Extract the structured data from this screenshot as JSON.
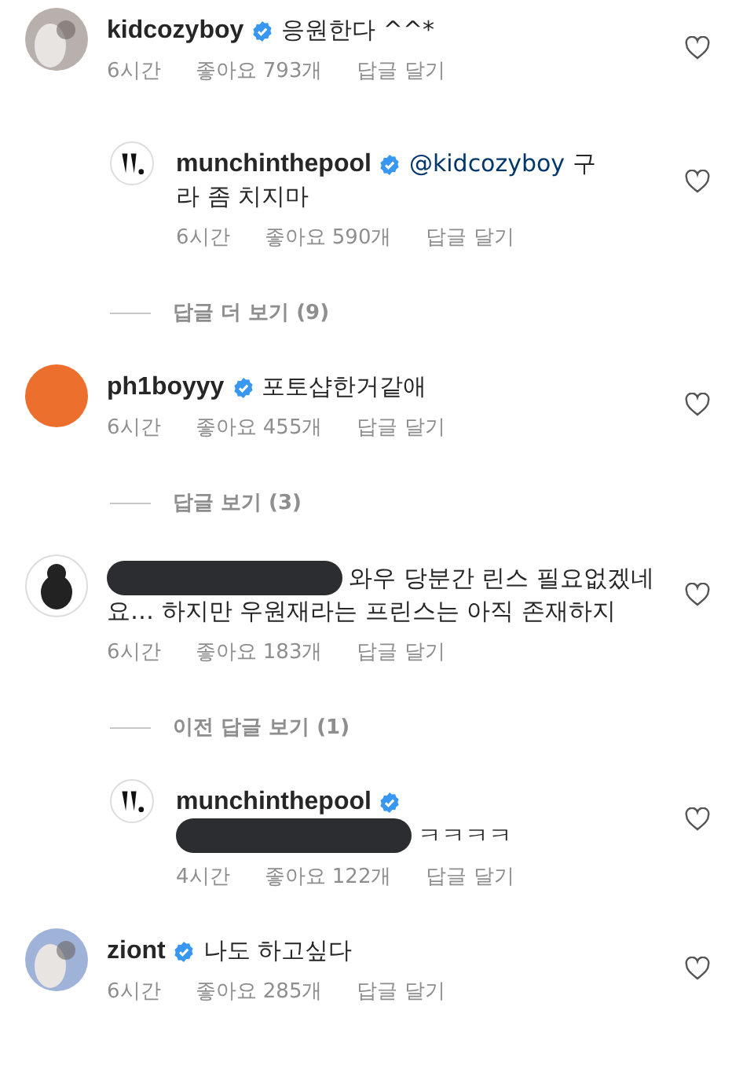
{
  "comments": [
    {
      "username": "kidcozyboy",
      "verified": true,
      "text": [
        "응원한다 ^^*"
      ],
      "avatar": {
        "kind": "photo",
        "color": "#b8b0ac"
      },
      "time": "6시간",
      "likes": "좋아요 793개",
      "reply": "답글 달기",
      "liked": false,
      "children": [
        {
          "kind": "reply",
          "username": "munchinthepool",
          "verified": true,
          "mention": "@kidcozyboy",
          "text": [
            "구",
            "라 좀 치지마"
          ],
          "avatar": {
            "kind": "logo",
            "color": "#111111"
          },
          "time": "6시간",
          "likes": "좋아요 590개",
          "reply": "답글 달기",
          "liked": false
        },
        {
          "kind": "toggle",
          "label": "답글 더 보기 (9)"
        }
      ]
    },
    {
      "username": "ph1boyyy",
      "verified": true,
      "text": [
        "포토샵한거같애"
      ],
      "avatar": {
        "kind": "plain",
        "color": "#ec6f2d"
      },
      "time": "6시간",
      "likes": "좋아요 455개",
      "reply": "답글 달기",
      "liked": false,
      "children": [
        {
          "kind": "toggle",
          "label": "답글 보기 (3)"
        }
      ]
    },
    {
      "redacted": true,
      "text": [
        "와우 당분간 린스 필요없겠네",
        "요… 하지만 우원재라는 프린스는 아직 존재하지"
      ],
      "avatar": {
        "kind": "figure",
        "color": "#222222"
      },
      "time": "6시간",
      "likes": "좋아요 183개",
      "reply": "답글 달기",
      "liked": false,
      "children": [
        {
          "kind": "toggle",
          "label": "이전 답글 보기 (1)"
        },
        {
          "kind": "reply",
          "username": "munchinthepool",
          "verified": true,
          "redacted": true,
          "text": [
            "ㅋㅋㅋㅋ"
          ],
          "avatar": {
            "kind": "logo",
            "color": "#111111"
          },
          "time": "4시간",
          "likes": "좋아요 122개",
          "reply": "답글 달기",
          "liked": false
        }
      ]
    },
    {
      "username": "ziont",
      "verified": true,
      "text": [
        "나도 하고싶다"
      ],
      "avatar": {
        "kind": "photo",
        "color": "#9fb2d8"
      },
      "time": "6시간",
      "likes": "좋아요 285개",
      "reply": "답글 달기",
      "liked": false
    }
  ]
}
